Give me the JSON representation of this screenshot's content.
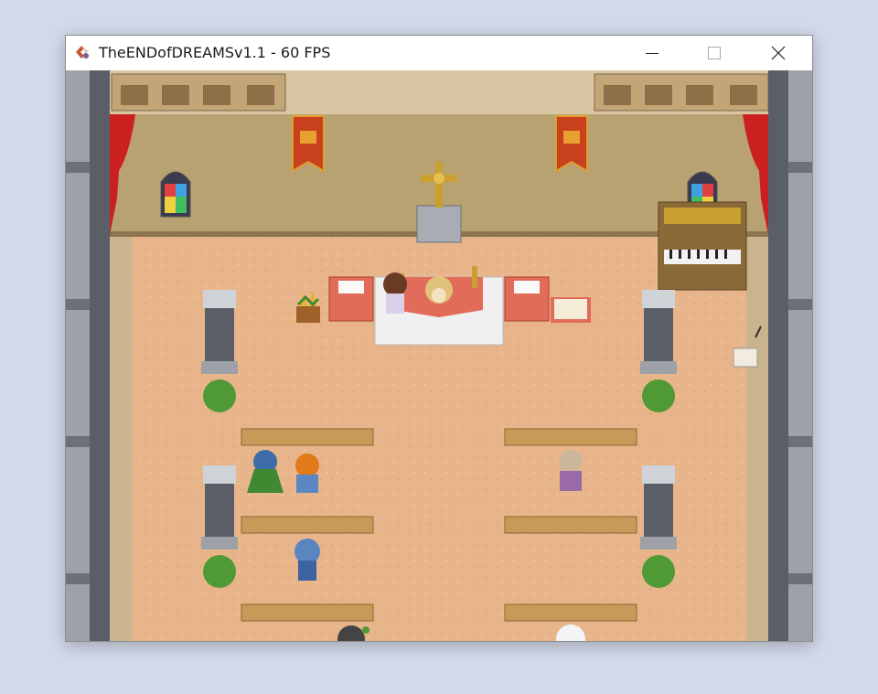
{
  "window": {
    "title": "TheENDofDREAMSv1.1 - 60 FPS",
    "icon": "game-app-icon",
    "controls": [
      "minimize-icon",
      "maximize-icon",
      "close-icon"
    ]
  },
  "scene": {
    "location": "chapel",
    "colors": {
      "floor": "#e8b58b",
      "wall": "#b9a272",
      "pillar_stone": "#9ea2a8",
      "pew": "#c89a5a",
      "altar_cloth": "#e26b5a",
      "banner": "#c8401e",
      "curtain": "#cc1f1f",
      "plant": "#4f9a34"
    }
  }
}
